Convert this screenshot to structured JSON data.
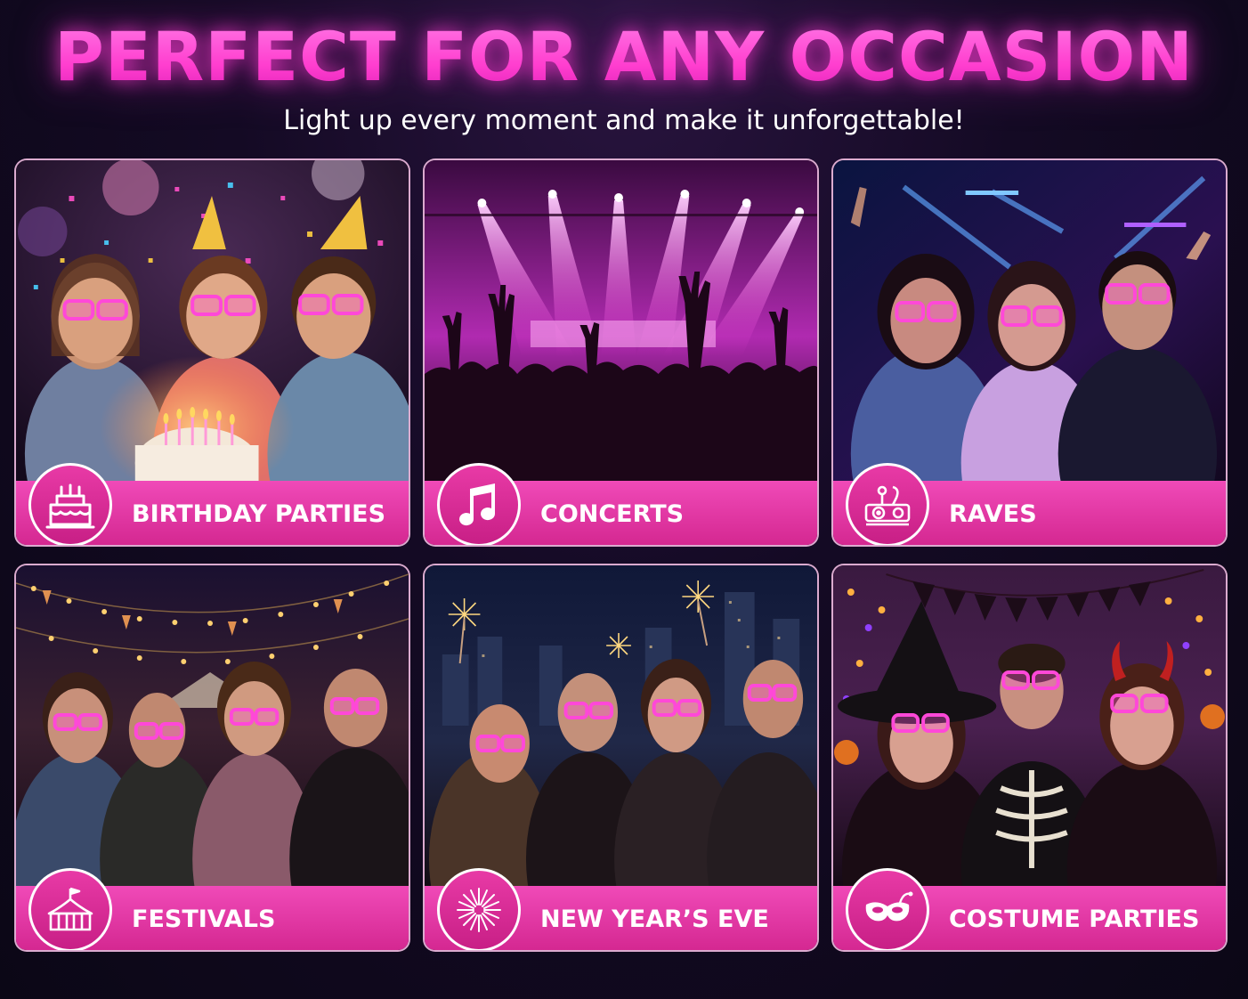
{
  "header": {
    "title": "PERFECT FOR ANY OCCASION",
    "subtitle": "Light up every moment and make it unforgettable!"
  },
  "colors": {
    "neon_pink": "#ff3ecf",
    "label_bar": "#e03aa6",
    "background": "#140a24"
  },
  "occasions": [
    {
      "label": "BIRTHDAY PARTIES",
      "icon": "birthday-cake-icon"
    },
    {
      "label": "CONCERTS",
      "icon": "music-note-icon"
    },
    {
      "label": "RAVES",
      "icon": "dj-turntable-icon"
    },
    {
      "label": "FESTIVALS",
      "icon": "circus-tent-icon"
    },
    {
      "label": "NEW YEAR’S EVE",
      "icon": "fireworks-icon"
    },
    {
      "label": "COSTUME PARTIES",
      "icon": "masquerade-mask-icon"
    }
  ]
}
